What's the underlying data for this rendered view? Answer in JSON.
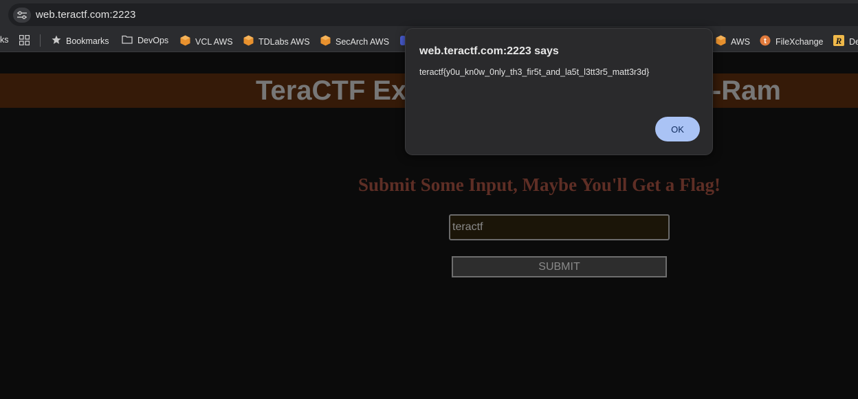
{
  "browser": {
    "url": "web.teractf.com:2223",
    "bookmarks": {
      "partial_left": "ks",
      "bookmarks_label": "Bookmarks",
      "items": [
        {
          "label": "DevOps",
          "icon": "folder-icon"
        },
        {
          "label": "VCL AWS",
          "icon": "aws-cube-icon"
        },
        {
          "label": "TDLabs AWS",
          "icon": "aws-cube-icon"
        },
        {
          "label": "SecArch AWS",
          "icon": "aws-cube-icon"
        },
        {
          "label": "AWS",
          "icon": "aws-cube-icon"
        },
        {
          "label": "FileXchange",
          "icon": "filexchange-icon"
        },
        {
          "label": "De",
          "icon": "r-icon"
        }
      ]
    }
  },
  "page": {
    "banner_title": "TeraCTF Ex                              ess-O-Ram",
    "heading": "Submit Some Input, Maybe You'll Get a Flag!",
    "input_value": "teractf",
    "submit_label": "SUBMIT"
  },
  "dialog": {
    "title": "web.teractf.com:2223 says",
    "message": "teractf{y0u_kn0w_0nly_th3_fir5t_and_la5t_l3tt3r5_matt3r3d}",
    "ok_label": "OK"
  },
  "colors": {
    "banner_bg": "#351a08",
    "heading": "#5e2e25",
    "ok_button": "#aac3f5"
  }
}
